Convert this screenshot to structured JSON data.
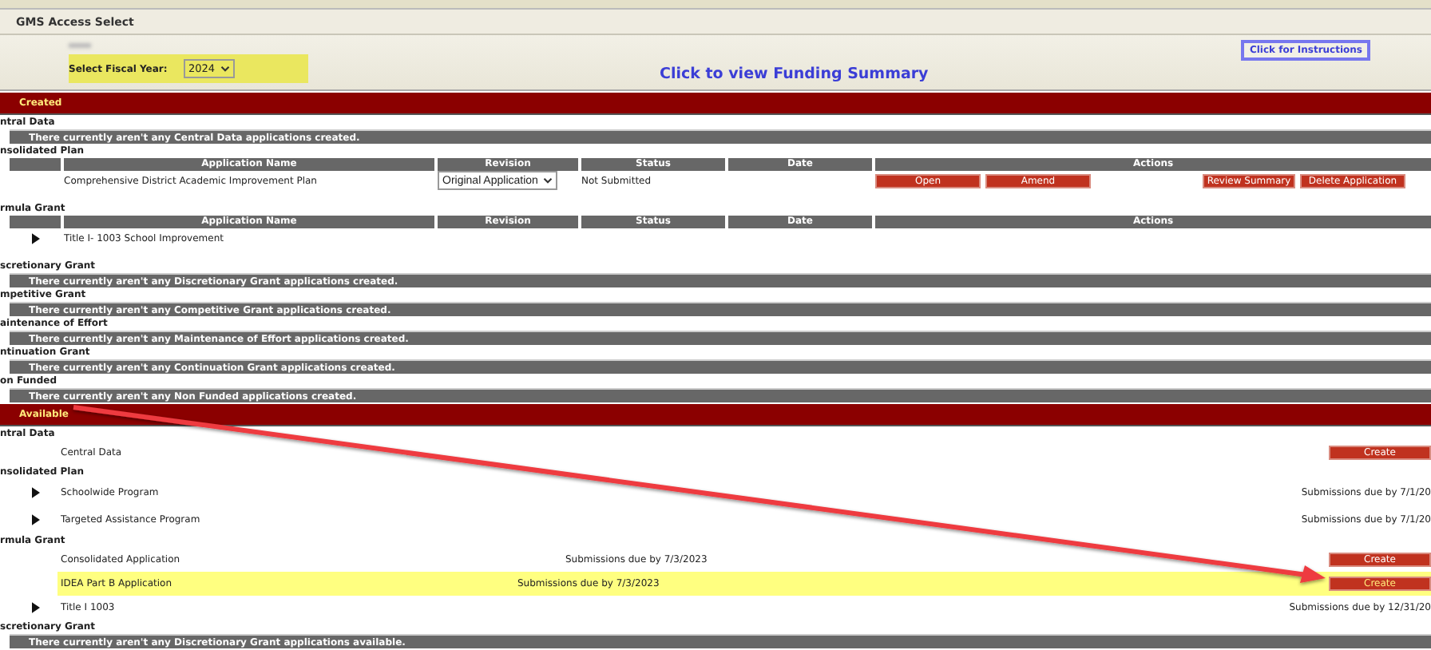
{
  "title": "GMS Access Select",
  "fiscal_year": {
    "label": "Select Fiscal Year:",
    "value": "2024",
    "highlighted": true
  },
  "funding_link": "Click to view Funding Summary",
  "instructions_button": "Click for Instructions",
  "created": {
    "title": "Created",
    "sections": [
      {
        "heading": "ntral Data",
        "kind": "empty",
        "message": "There currently aren't any Central Data applications created."
      },
      {
        "heading": "nsolidated Plan",
        "kind": "table",
        "columns": [
          "Application Name",
          "Revision",
          "Status",
          "Date",
          "Actions"
        ],
        "rows": [
          {
            "expandable": false,
            "name": "Comprehensive District Academic Improvement Plan",
            "revision": "Original Application",
            "status": "Not Submitted",
            "actions": [
              "Open",
              "Amend",
              "Review Summary",
              "Delete Application"
            ]
          }
        ]
      },
      {
        "heading": "rmula Grant",
        "kind": "table",
        "columns": [
          "Application Name",
          "Revision",
          "Status",
          "Date",
          "Actions"
        ],
        "rows": [
          {
            "expandable": true,
            "name": "Title I- 1003 School Improvement"
          }
        ]
      },
      {
        "heading": "scretionary Grant",
        "kind": "empty",
        "message": "There currently aren't any Discretionary Grant applications created."
      },
      {
        "heading": "mpetitive Grant",
        "kind": "empty",
        "message": "There currently aren't any Competitive Grant applications created."
      },
      {
        "heading": "aintenance of Effort",
        "kind": "empty",
        "message": "There currently aren't any Maintenance of Effort applications created."
      },
      {
        "heading": "ntinuation Grant",
        "kind": "empty",
        "message": "There currently aren't any Continuation Grant applications created."
      },
      {
        "heading": "on Funded",
        "kind": "empty",
        "message": "There currently aren't any Non Funded applications created."
      }
    ]
  },
  "available": {
    "title": "Available",
    "sections": [
      {
        "heading": "ntral Data",
        "kind": "list",
        "items": [
          {
            "name": "Central Data",
            "expandable": false,
            "highlighted": false,
            "button": "Create"
          }
        ]
      },
      {
        "heading": "nsolidated Plan",
        "kind": "list",
        "items": [
          {
            "name": "Schoolwide Program",
            "expandable": true,
            "highlighted": false,
            "due": "Submissions due by 7/1/20"
          },
          {
            "name": "Targeted Assistance Program",
            "expandable": true,
            "highlighted": false,
            "due": "Submissions due by 7/1/20"
          }
        ]
      },
      {
        "heading": "rmula Grant",
        "kind": "list",
        "items": [
          {
            "name": "Consolidated Application",
            "expandable": false,
            "highlighted": false,
            "due": "Submissions due by 7/3/2023",
            "button": "Create"
          },
          {
            "name": "IDEA Part B Application",
            "expandable": false,
            "highlighted": true,
            "due": "Submissions due by 7/3/2023",
            "button": "Create"
          },
          {
            "name": "Title I 1003",
            "expandable": true,
            "highlighted": false,
            "right_due": "Submissions due by 12/31/20"
          }
        ]
      },
      {
        "heading": "scretionary Grant",
        "kind": "empty",
        "message": "There currently aren't any Discretionary Grant applications available."
      }
    ]
  }
}
